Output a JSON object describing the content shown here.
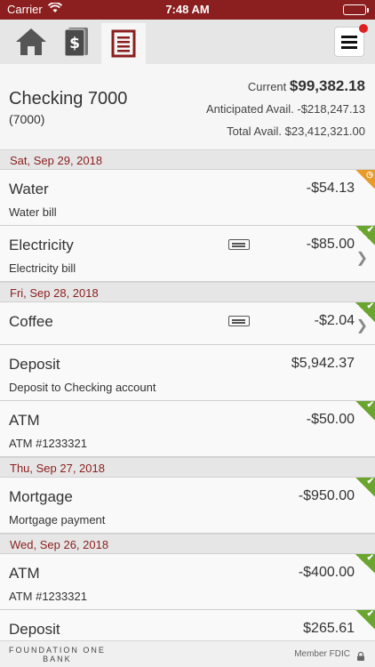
{
  "status_bar": {
    "carrier": "Carrier",
    "time": "7:48 AM"
  },
  "nav": {
    "icons": [
      "home-icon",
      "dollar-icon",
      "register-icon",
      "menu-icon"
    ],
    "active": "register-icon"
  },
  "account": {
    "name": "Checking 7000",
    "number": "(7000)",
    "current_label": "Current",
    "current_value": "$99,382.18",
    "anticipated": "Anticipated Avail. -$218,247.13",
    "total": "Total Avail. $23,412,321.00"
  },
  "groups": [
    {
      "date": "Sat, Sep 29, 2018",
      "transactions": [
        {
          "title": "Water",
          "desc": "Water bill",
          "amount": "-$54.13",
          "status": "pending"
        },
        {
          "title": "Electricity",
          "desc": "Electricity bill",
          "amount": "-$85.00",
          "status": "cleared",
          "has_memo": true
        }
      ]
    },
    {
      "date": "Fri, Sep 28, 2018",
      "transactions": [
        {
          "title": "Coffee",
          "desc": "",
          "amount": "-$2.04",
          "status": "cleared",
          "has_memo": true
        },
        {
          "title": "Deposit",
          "desc": "Deposit to Checking account",
          "amount": "$5,942.37",
          "status": "none"
        },
        {
          "title": "ATM",
          "desc": "ATM #1233321",
          "amount": "-$50.00",
          "status": "cleared"
        }
      ]
    },
    {
      "date": "Thu, Sep 27, 2018",
      "transactions": [
        {
          "title": "Mortgage",
          "desc": "Mortgage payment",
          "amount": "-$950.00",
          "status": "cleared"
        }
      ]
    },
    {
      "date": "Wed, Sep 26, 2018",
      "transactions": [
        {
          "title": "ATM",
          "desc": "ATM #1233321",
          "amount": "-$400.00",
          "status": "cleared"
        },
        {
          "title": "Deposit",
          "desc": "",
          "amount": "$265.61",
          "status": "cleared"
        }
      ]
    }
  ],
  "footer": {
    "logo_line1": "FOUNDATION ONE",
    "logo_line2": "BANK",
    "fdic": "Member FDIC"
  },
  "colors": {
    "brand": "#8b1e1e",
    "cleared": "#6aa52f",
    "pending": "#e89b2a",
    "notification": "#e02020"
  }
}
